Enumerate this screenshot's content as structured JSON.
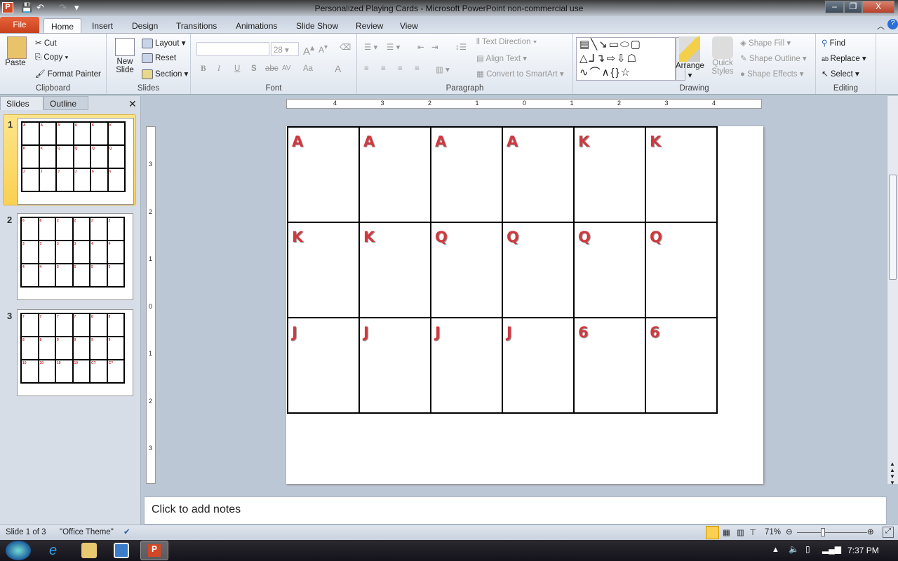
{
  "window": {
    "title": "Personalized Playing Cards  -  Microsoft PowerPoint non-commercial use",
    "min": "–",
    "max": "❐",
    "close": "X"
  },
  "tabs": [
    "File",
    "Home",
    "Insert",
    "Design",
    "Transitions",
    "Animations",
    "Slide Show",
    "Review",
    "View"
  ],
  "ribbon": {
    "clipboard": {
      "label": "Clipboard",
      "paste": "Paste",
      "cut": "Cut",
      "copy": "Copy",
      "format_painter": "Format Painter"
    },
    "slides": {
      "label": "Slides",
      "new_slide": "New Slide",
      "layout": "Layout",
      "reset": "Reset",
      "section": "Section"
    },
    "font": {
      "label": "Font",
      "font_name": "",
      "font_size": "28",
      "bold": "B",
      "italic": "I",
      "underline": "U",
      "shadow": "S",
      "strike": "abc",
      "spacing": "AV",
      "case": "Aa",
      "color": "A"
    },
    "paragraph": {
      "label": "Paragraph",
      "text_direction": "Text Direction",
      "align_text": "Align Text",
      "convert_smartart": "Convert to SmartArt"
    },
    "drawing": {
      "label": "Drawing",
      "arrange": "Arrange",
      "quick_styles": "Quick Styles",
      "shape_fill": "Shape Fill",
      "shape_outline": "Shape Outline",
      "shape_effects": "Shape Effects"
    },
    "editing": {
      "label": "Editing",
      "find": "Find",
      "replace": "Replace",
      "select": "Select"
    }
  },
  "pane": {
    "tabs": [
      "Slides",
      "Outline"
    ],
    "thumbnails": [
      {
        "num": "1",
        "cards": [
          "A",
          "A",
          "A",
          "A",
          "K",
          "K",
          "K",
          "K",
          "Q",
          "Q",
          "Q",
          "Q",
          "J",
          "J",
          "J",
          "J",
          "6",
          "6"
        ]
      },
      {
        "num": "2",
        "cards": [
          "6",
          "6",
          "2",
          "2",
          "2",
          "2",
          "3",
          "3",
          "3",
          "3",
          "4",
          "4",
          "4",
          "4",
          "5",
          "5",
          "5",
          "5"
        ]
      },
      {
        "num": "3",
        "cards": [
          "7",
          "7",
          "7",
          "7",
          "8",
          "8",
          "8",
          "8",
          "9",
          "9",
          "9",
          "9",
          "10",
          "10",
          "10",
          "10",
          "C?",
          "C?"
        ]
      }
    ]
  },
  "ruler": {
    "h": [
      "4",
      "3",
      "2",
      "1",
      "0",
      "1",
      "2",
      "3",
      "4"
    ],
    "v": [
      "3",
      "2",
      "1",
      "0",
      "1",
      "2",
      "3"
    ]
  },
  "slide": {
    "cards": [
      "A",
      "A",
      "A",
      "A",
      "K",
      "K",
      "K",
      "K",
      "Q",
      "Q",
      "Q",
      "Q",
      "J",
      "J",
      "J",
      "J",
      "6",
      "6"
    ],
    "card_color": "#d0393f"
  },
  "notes": {
    "placeholder": "Click to add notes"
  },
  "status": {
    "slide": "Slide 1 of 3",
    "theme": "\"Office Theme\"",
    "zoom": "71%",
    "zoom_level": 71
  },
  "taskbar": {
    "time": "7:37 PM"
  }
}
